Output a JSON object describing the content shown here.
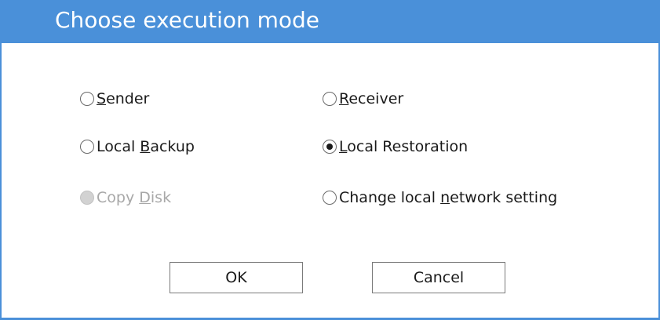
{
  "dialog": {
    "title": "Choose execution mode"
  },
  "options": [
    {
      "id": "sender",
      "pre": "",
      "key": "S",
      "post": "ender",
      "checked": false,
      "disabled": false
    },
    {
      "id": "receiver",
      "pre": "",
      "key": "R",
      "post": "eceiver",
      "checked": false,
      "disabled": false
    },
    {
      "id": "local-backup",
      "pre": "Local ",
      "key": "B",
      "post": "ackup",
      "checked": false,
      "disabled": false
    },
    {
      "id": "local-restoration",
      "pre": "",
      "key": "L",
      "post": "ocal Restoration",
      "checked": true,
      "disabled": false
    },
    {
      "id": "copy-disk",
      "pre": "Copy ",
      "key": "D",
      "post": "isk",
      "checked": false,
      "disabled": true
    },
    {
      "id": "change-network",
      "pre": "Change local ",
      "key": "n",
      "post": "etwork setting",
      "checked": false,
      "disabled": false
    }
  ],
  "buttons": {
    "ok": "OK",
    "cancel": "Cancel"
  }
}
